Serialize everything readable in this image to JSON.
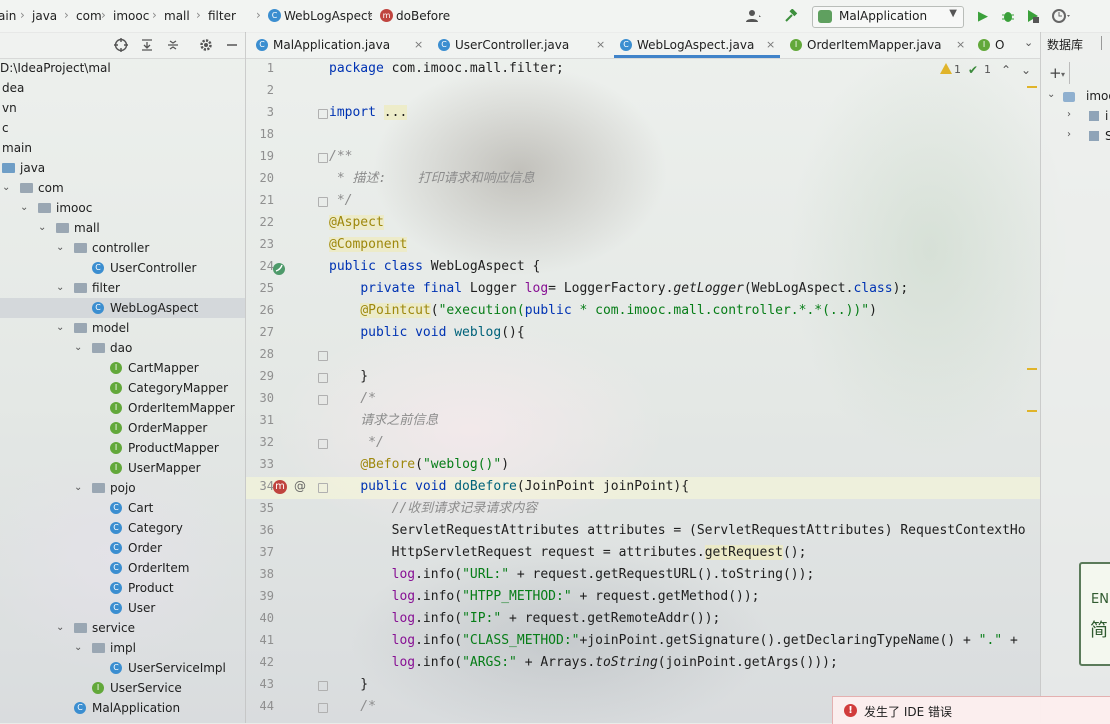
{
  "breadcrumbs": [
    {
      "label": "ain",
      "icon": "none"
    },
    {
      "label": "java",
      "icon": "none"
    },
    {
      "label": "com",
      "icon": "none"
    },
    {
      "label": "imooc",
      "icon": "none"
    },
    {
      "label": "mall",
      "icon": "none"
    },
    {
      "label": "filter",
      "icon": "none"
    },
    {
      "label": "WebLogAspect",
      "icon": "class-icon"
    },
    {
      "label": "doBefore",
      "icon": "method-icon"
    }
  ],
  "run_config": {
    "label": "MalApplication"
  },
  "colors": {
    "accent": "#4083c9",
    "keyword": "#0033b3",
    "annotation": "#9e880d",
    "string": "#067d17",
    "comment": "#8c8c8c",
    "field": "#871094",
    "error": "#d13b3b"
  },
  "project_tree": [
    {
      "label": "D:\\IdeaProject\\mal",
      "type": "path",
      "selected": false
    },
    {
      "label": "dea",
      "type": "folder",
      "selected": false
    },
    {
      "label": "vn",
      "type": "folder",
      "selected": false
    },
    {
      "label": "c",
      "type": "folder",
      "selected": false
    },
    {
      "label": "main",
      "type": "folder",
      "selected": false
    },
    {
      "label": "java",
      "type": "folder-blue",
      "selected": false
    },
    {
      "label": "com",
      "type": "folder",
      "selected": false
    },
    {
      "label": "imooc",
      "type": "folder",
      "selected": false
    },
    {
      "label": "mall",
      "type": "folder",
      "selected": false
    },
    {
      "label": "controller",
      "type": "folder",
      "selected": false
    },
    {
      "label": "UserController",
      "type": "class",
      "selected": false
    },
    {
      "label": "filter",
      "type": "folder",
      "selected": false
    },
    {
      "label": "WebLogAspect",
      "type": "class",
      "selected": true
    },
    {
      "label": "model",
      "type": "folder",
      "selected": false
    },
    {
      "label": "dao",
      "type": "folder",
      "selected": false
    },
    {
      "label": "CartMapper",
      "type": "interface",
      "selected": false
    },
    {
      "label": "CategoryMapper",
      "type": "interface",
      "selected": false
    },
    {
      "label": "OrderItemMapper",
      "type": "interface",
      "selected": false
    },
    {
      "label": "OrderMapper",
      "type": "interface",
      "selected": false
    },
    {
      "label": "ProductMapper",
      "type": "interface",
      "selected": false
    },
    {
      "label": "UserMapper",
      "type": "interface",
      "selected": false
    },
    {
      "label": "pojo",
      "type": "folder",
      "selected": false
    },
    {
      "label": "Cart",
      "type": "class",
      "selected": false
    },
    {
      "label": "Category",
      "type": "class",
      "selected": false
    },
    {
      "label": "Order",
      "type": "class",
      "selected": false
    },
    {
      "label": "OrderItem",
      "type": "class",
      "selected": false
    },
    {
      "label": "Product",
      "type": "class",
      "selected": false
    },
    {
      "label": "User",
      "type": "class",
      "selected": false
    },
    {
      "label": "service",
      "type": "folder",
      "selected": false
    },
    {
      "label": "impl",
      "type": "folder",
      "selected": false
    },
    {
      "label": "UserServiceImpl",
      "type": "class",
      "selected": false
    },
    {
      "label": "UserService",
      "type": "interface",
      "selected": false
    },
    {
      "label": "MalApplication",
      "type": "class",
      "selected": false
    }
  ],
  "tabs": [
    {
      "label": "MalApplication.java",
      "icon": "class",
      "active": false,
      "closable": true
    },
    {
      "label": "UserController.java",
      "icon": "class",
      "active": false,
      "closable": true
    },
    {
      "label": "WebLogAspect.java",
      "icon": "class",
      "active": true,
      "closable": true
    },
    {
      "label": "OrderItemMapper.java",
      "icon": "interface",
      "active": false,
      "closable": true
    },
    {
      "label": "O",
      "icon": "interface",
      "active": false,
      "closable": false
    }
  ],
  "inspections": {
    "warnings": "1",
    "weak_warnings": "1"
  },
  "line_numbers": [
    "1",
    "2",
    "3",
    "18",
    "19",
    "20",
    "21",
    "22",
    "23",
    "24",
    "25",
    "26",
    "27",
    "28",
    "29",
    "30",
    "31",
    "32",
    "33",
    "34",
    "35",
    "36",
    "37",
    "38",
    "39",
    "40",
    "41",
    "42",
    "43",
    "44"
  ],
  "code_lines": [
    [
      {
        "t": "package ",
        "c": "kw"
      },
      {
        "t": "com.imooc.mall.filter;",
        "c": ""
      }
    ],
    [],
    [
      {
        "t": "import ",
        "c": "kw"
      },
      {
        "t": "...",
        "c": "hl"
      }
    ],
    [],
    [
      {
        "t": "/**",
        "c": "cm"
      }
    ],
    [
      {
        "t": " * 描述:    打印请求和响应信息",
        "c": "cm"
      }
    ],
    [
      {
        "t": " */",
        "c": "cm"
      }
    ],
    [
      {
        "t": "@Aspect",
        "c": "an hl"
      }
    ],
    [
      {
        "t": "@Component",
        "c": "an hl"
      }
    ],
    [
      {
        "t": "public class ",
        "c": "kw"
      },
      {
        "t": "WebLogAspect {",
        "c": ""
      }
    ],
    [
      {
        "t": "    "
      },
      {
        "t": "private final ",
        "c": "kw"
      },
      {
        "t": "Logger ",
        "c": ""
      },
      {
        "t": "log",
        "c": "lg"
      },
      {
        "t": "= LoggerFactory.",
        "c": ""
      },
      {
        "t": "getLogger",
        "c": "it"
      },
      {
        "t": "(WebLogAspect.",
        "c": ""
      },
      {
        "t": "class",
        "c": "kw"
      },
      {
        "t": ");",
        "c": ""
      }
    ],
    [
      {
        "t": "    "
      },
      {
        "t": "@Pointcut",
        "c": "an hl"
      },
      {
        "t": "(",
        "c": ""
      },
      {
        "t": "\"execution(",
        "c": "st"
      },
      {
        "t": "public",
        "c": "kw"
      },
      {
        "t": " * com.imooc.mall.controller.*.*(..))\"",
        "c": "st"
      },
      {
        "t": ")",
        "c": ""
      }
    ],
    [
      {
        "t": "    "
      },
      {
        "t": "public void ",
        "c": "kw"
      },
      {
        "t": "weblog",
        "c": "fn"
      },
      {
        "t": "(){",
        "c": ""
      }
    ],
    [],
    [
      {
        "t": "    }",
        "c": ""
      }
    ],
    [
      {
        "t": "    /*",
        "c": "cm"
      }
    ],
    [
      {
        "t": "    请求之前信息",
        "c": "cm"
      }
    ],
    [
      {
        "t": "     */",
        "c": "cm"
      }
    ],
    [
      {
        "t": "    "
      },
      {
        "t": "@Before",
        "c": "an"
      },
      {
        "t": "(",
        "c": ""
      },
      {
        "t": "\"weblog()\"",
        "c": "st"
      },
      {
        "t": ")",
        "c": ""
      }
    ],
    [
      {
        "t": "    "
      },
      {
        "t": "public void ",
        "c": "kw"
      },
      {
        "t": "doBefore",
        "c": "fn"
      },
      {
        "t": "(JoinPoint joinPoint){",
        "c": ""
      }
    ],
    [
      {
        "t": "        //收到请求记录请求内容",
        "c": "cm"
      }
    ],
    [
      {
        "t": "        ServletRequestAttributes attributes = (ServletRequestAttributes) RequestContextHo",
        "c": ""
      }
    ],
    [
      {
        "t": "        HttpServletRequest request = attributes.",
        "c": ""
      },
      {
        "t": "getRequest",
        "c": "hl"
      },
      {
        "t": "();",
        "c": ""
      }
    ],
    [
      {
        "t": "        "
      },
      {
        "t": "log",
        "c": "lg"
      },
      {
        "t": ".info(",
        "c": ""
      },
      {
        "t": "\"URL:\"",
        "c": "st"
      },
      {
        "t": " + request.getRequestURL().toString());",
        "c": ""
      }
    ],
    [
      {
        "t": "        "
      },
      {
        "t": "log",
        "c": "lg"
      },
      {
        "t": ".info(",
        "c": ""
      },
      {
        "t": "\"HTPP_METHOD:\"",
        "c": "st"
      },
      {
        "t": " + request.getMethod());",
        "c": ""
      }
    ],
    [
      {
        "t": "        "
      },
      {
        "t": "log",
        "c": "lg"
      },
      {
        "t": ".info(",
        "c": ""
      },
      {
        "t": "\"IP:\"",
        "c": "st"
      },
      {
        "t": " + request.getRemoteAddr());",
        "c": ""
      }
    ],
    [
      {
        "t": "        "
      },
      {
        "t": "log",
        "c": "lg"
      },
      {
        "t": ".info(",
        "c": ""
      },
      {
        "t": "\"CLASS_METHOD:\"",
        "c": "st"
      },
      {
        "t": "+joinPoint.getSignature().getDeclaringTypeName() + ",
        "c": ""
      },
      {
        "t": "\".\"",
        "c": "st"
      },
      {
        "t": " +",
        "c": ""
      }
    ],
    [
      {
        "t": "        "
      },
      {
        "t": "log",
        "c": "lg"
      },
      {
        "t": ".info(",
        "c": ""
      },
      {
        "t": "\"ARGS:\"",
        "c": "st"
      },
      {
        "t": " + Arrays.",
        "c": ""
      },
      {
        "t": "toString",
        "c": "it"
      },
      {
        "t": "(joinPoint.getArgs()));",
        "c": ""
      }
    ],
    [
      {
        "t": "    }",
        "c": ""
      }
    ],
    [
      {
        "t": "    /*",
        "c": "cm"
      }
    ]
  ],
  "right_panel": {
    "title": "数据库",
    "tree": [
      "imoo",
      "i",
      "S"
    ]
  },
  "floating_card": {
    "line1": "EN",
    "line2": "简"
  },
  "notification": {
    "text": "发生了 IDE 错误"
  }
}
